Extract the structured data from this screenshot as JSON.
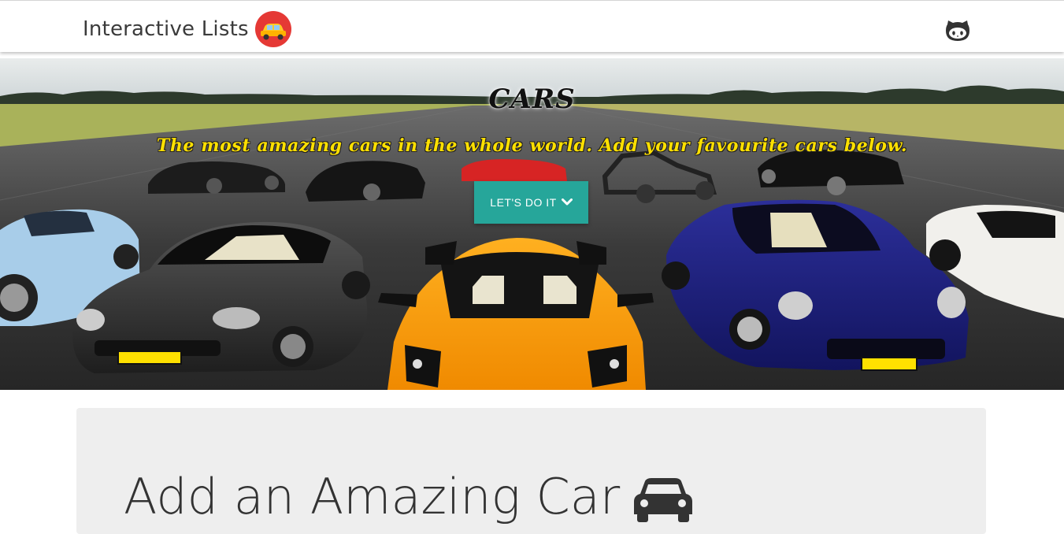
{
  "navbar": {
    "brand_text": "Interactive Lists",
    "brand_logo_icon": "car-logo-icon",
    "github_icon": "github-icon"
  },
  "hero": {
    "title": "CARS",
    "subtitle": "The most amazing cars in the whole world. Add your favourite cars below.",
    "cta_label": "LET'S DO IT",
    "cta_icon": "chevron-down-icon"
  },
  "form_card": {
    "heading": "Add an Amazing Car",
    "heading_icon": "car-icon"
  },
  "colors": {
    "accent": "#26a69a",
    "logo_bg": "#e53935",
    "subtitle": "#ffe000",
    "card_bg": "#eeeeee"
  }
}
